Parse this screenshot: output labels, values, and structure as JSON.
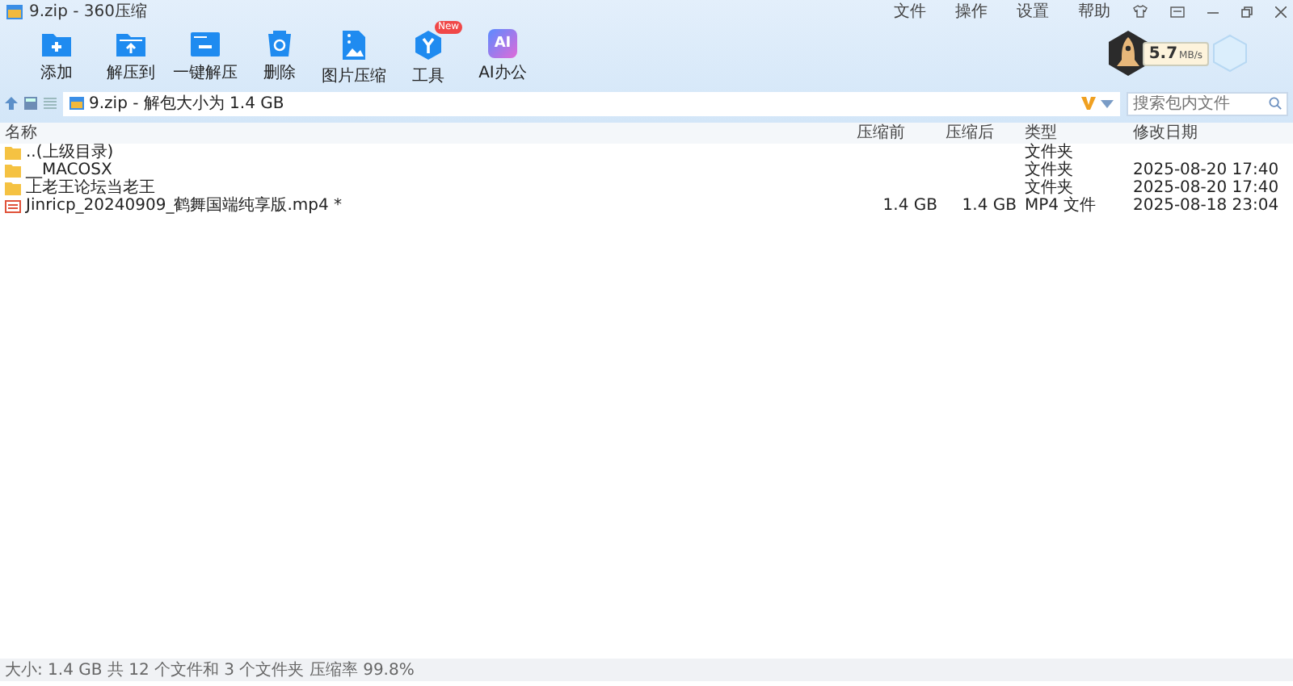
{
  "window": {
    "title": "9.zip - 360压缩",
    "menus": [
      "文件",
      "操作",
      "设置",
      "帮助"
    ]
  },
  "toolbar": [
    {
      "label": "添加",
      "kind": "add"
    },
    {
      "label": "解压到",
      "kind": "extract"
    },
    {
      "label": "一键解压",
      "kind": "oneclick"
    },
    {
      "label": "删除",
      "kind": "delete"
    },
    {
      "label": "图片压缩",
      "kind": "image"
    },
    {
      "label": "工具",
      "kind": "tools",
      "badge": "New"
    },
    {
      "label": "AI办公",
      "kind": "ai",
      "icon_text": "AI"
    }
  ],
  "speed": {
    "value": "5.7",
    "unit": "MB/s"
  },
  "address": {
    "path": "9.zip - 解包大小为 1.4 GB"
  },
  "search": {
    "placeholder": "搜索包内文件"
  },
  "table": {
    "columns": [
      "名称",
      "压缩前",
      "压缩后",
      "类型",
      "修改日期"
    ],
    "rows": [
      {
        "kind": "folder",
        "name": "..(上级目录)",
        "size": "",
        "packed": "",
        "type": "文件夹",
        "modified": ""
      },
      {
        "kind": "folder",
        "name": "__MACOSX",
        "size": "",
        "packed": "",
        "type": "文件夹",
        "modified": "2025-08-20 17:40"
      },
      {
        "kind": "folder",
        "name": "上老王论坛当老王",
        "size": "",
        "packed": "",
        "type": "文件夹",
        "modified": "2025-08-20 17:40"
      },
      {
        "kind": "video",
        "name": "Jinricp_20240909_鹤舞国端纯享版.mp4 *",
        "size": "1.4 GB",
        "packed": "1.4 GB",
        "type": "MP4 文件",
        "modified": "2025-08-18 23:04"
      }
    ]
  },
  "status_bar": "大小: 1.4 GB 共 12 个文件和 3 个文件夹 压缩率 99.8%"
}
